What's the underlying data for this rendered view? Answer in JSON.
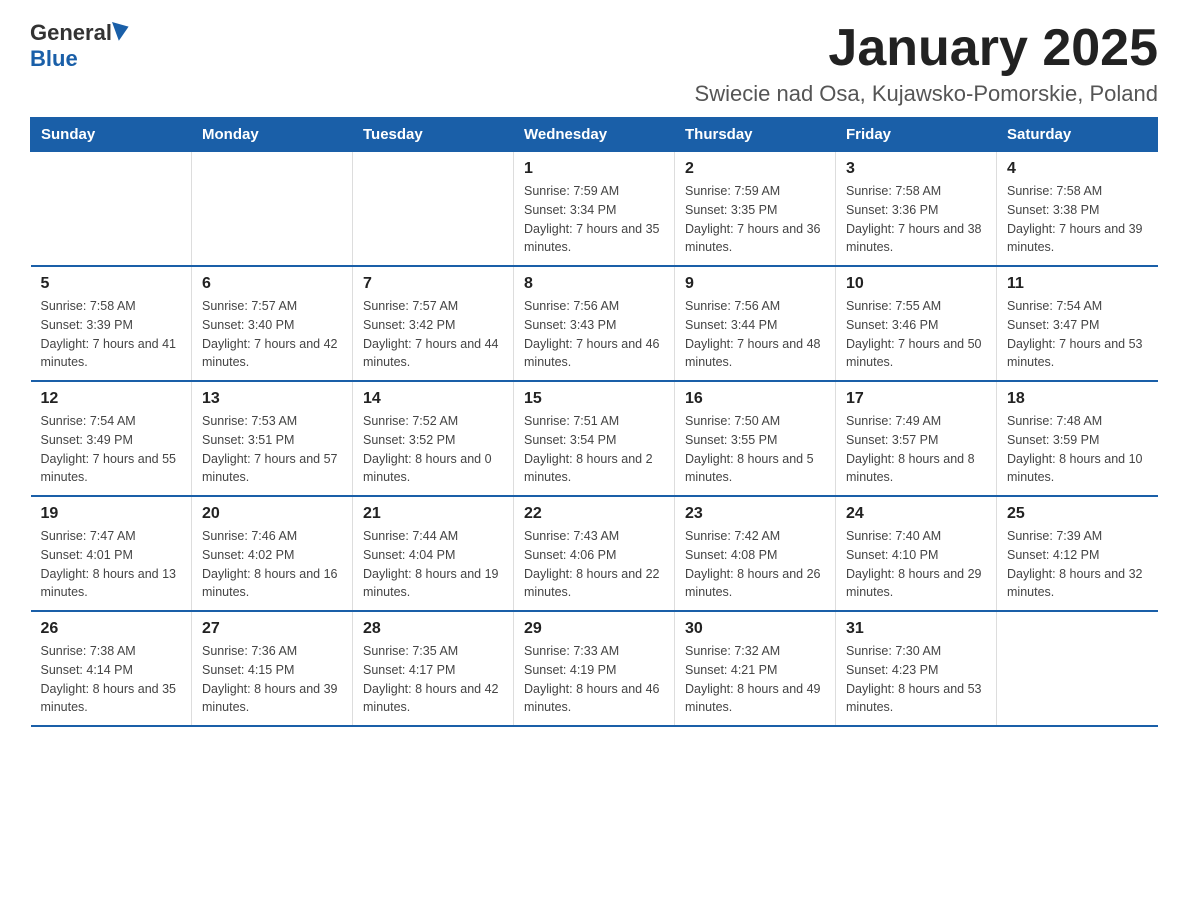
{
  "header": {
    "logo_general": "General",
    "logo_blue": "Blue",
    "title": "January 2025",
    "subtitle": "Swiecie nad Osa, Kujawsko-Pomorskie, Poland"
  },
  "days_of_week": [
    "Sunday",
    "Monday",
    "Tuesday",
    "Wednesday",
    "Thursday",
    "Friday",
    "Saturday"
  ],
  "weeks": [
    [
      {
        "day": "",
        "info": ""
      },
      {
        "day": "",
        "info": ""
      },
      {
        "day": "",
        "info": ""
      },
      {
        "day": "1",
        "info": "Sunrise: 7:59 AM\nSunset: 3:34 PM\nDaylight: 7 hours and 35 minutes."
      },
      {
        "day": "2",
        "info": "Sunrise: 7:59 AM\nSunset: 3:35 PM\nDaylight: 7 hours and 36 minutes."
      },
      {
        "day": "3",
        "info": "Sunrise: 7:58 AM\nSunset: 3:36 PM\nDaylight: 7 hours and 38 minutes."
      },
      {
        "day": "4",
        "info": "Sunrise: 7:58 AM\nSunset: 3:38 PM\nDaylight: 7 hours and 39 minutes."
      }
    ],
    [
      {
        "day": "5",
        "info": "Sunrise: 7:58 AM\nSunset: 3:39 PM\nDaylight: 7 hours and 41 minutes."
      },
      {
        "day": "6",
        "info": "Sunrise: 7:57 AM\nSunset: 3:40 PM\nDaylight: 7 hours and 42 minutes."
      },
      {
        "day": "7",
        "info": "Sunrise: 7:57 AM\nSunset: 3:42 PM\nDaylight: 7 hours and 44 minutes."
      },
      {
        "day": "8",
        "info": "Sunrise: 7:56 AM\nSunset: 3:43 PM\nDaylight: 7 hours and 46 minutes."
      },
      {
        "day": "9",
        "info": "Sunrise: 7:56 AM\nSunset: 3:44 PM\nDaylight: 7 hours and 48 minutes."
      },
      {
        "day": "10",
        "info": "Sunrise: 7:55 AM\nSunset: 3:46 PM\nDaylight: 7 hours and 50 minutes."
      },
      {
        "day": "11",
        "info": "Sunrise: 7:54 AM\nSunset: 3:47 PM\nDaylight: 7 hours and 53 minutes."
      }
    ],
    [
      {
        "day": "12",
        "info": "Sunrise: 7:54 AM\nSunset: 3:49 PM\nDaylight: 7 hours and 55 minutes."
      },
      {
        "day": "13",
        "info": "Sunrise: 7:53 AM\nSunset: 3:51 PM\nDaylight: 7 hours and 57 minutes."
      },
      {
        "day": "14",
        "info": "Sunrise: 7:52 AM\nSunset: 3:52 PM\nDaylight: 8 hours and 0 minutes."
      },
      {
        "day": "15",
        "info": "Sunrise: 7:51 AM\nSunset: 3:54 PM\nDaylight: 8 hours and 2 minutes."
      },
      {
        "day": "16",
        "info": "Sunrise: 7:50 AM\nSunset: 3:55 PM\nDaylight: 8 hours and 5 minutes."
      },
      {
        "day": "17",
        "info": "Sunrise: 7:49 AM\nSunset: 3:57 PM\nDaylight: 8 hours and 8 minutes."
      },
      {
        "day": "18",
        "info": "Sunrise: 7:48 AM\nSunset: 3:59 PM\nDaylight: 8 hours and 10 minutes."
      }
    ],
    [
      {
        "day": "19",
        "info": "Sunrise: 7:47 AM\nSunset: 4:01 PM\nDaylight: 8 hours and 13 minutes."
      },
      {
        "day": "20",
        "info": "Sunrise: 7:46 AM\nSunset: 4:02 PM\nDaylight: 8 hours and 16 minutes."
      },
      {
        "day": "21",
        "info": "Sunrise: 7:44 AM\nSunset: 4:04 PM\nDaylight: 8 hours and 19 minutes."
      },
      {
        "day": "22",
        "info": "Sunrise: 7:43 AM\nSunset: 4:06 PM\nDaylight: 8 hours and 22 minutes."
      },
      {
        "day": "23",
        "info": "Sunrise: 7:42 AM\nSunset: 4:08 PM\nDaylight: 8 hours and 26 minutes."
      },
      {
        "day": "24",
        "info": "Sunrise: 7:40 AM\nSunset: 4:10 PM\nDaylight: 8 hours and 29 minutes."
      },
      {
        "day": "25",
        "info": "Sunrise: 7:39 AM\nSunset: 4:12 PM\nDaylight: 8 hours and 32 minutes."
      }
    ],
    [
      {
        "day": "26",
        "info": "Sunrise: 7:38 AM\nSunset: 4:14 PM\nDaylight: 8 hours and 35 minutes."
      },
      {
        "day": "27",
        "info": "Sunrise: 7:36 AM\nSunset: 4:15 PM\nDaylight: 8 hours and 39 minutes."
      },
      {
        "day": "28",
        "info": "Sunrise: 7:35 AM\nSunset: 4:17 PM\nDaylight: 8 hours and 42 minutes."
      },
      {
        "day": "29",
        "info": "Sunrise: 7:33 AM\nSunset: 4:19 PM\nDaylight: 8 hours and 46 minutes."
      },
      {
        "day": "30",
        "info": "Sunrise: 7:32 AM\nSunset: 4:21 PM\nDaylight: 8 hours and 49 minutes."
      },
      {
        "day": "31",
        "info": "Sunrise: 7:30 AM\nSunset: 4:23 PM\nDaylight: 8 hours and 53 minutes."
      },
      {
        "day": "",
        "info": ""
      }
    ]
  ]
}
